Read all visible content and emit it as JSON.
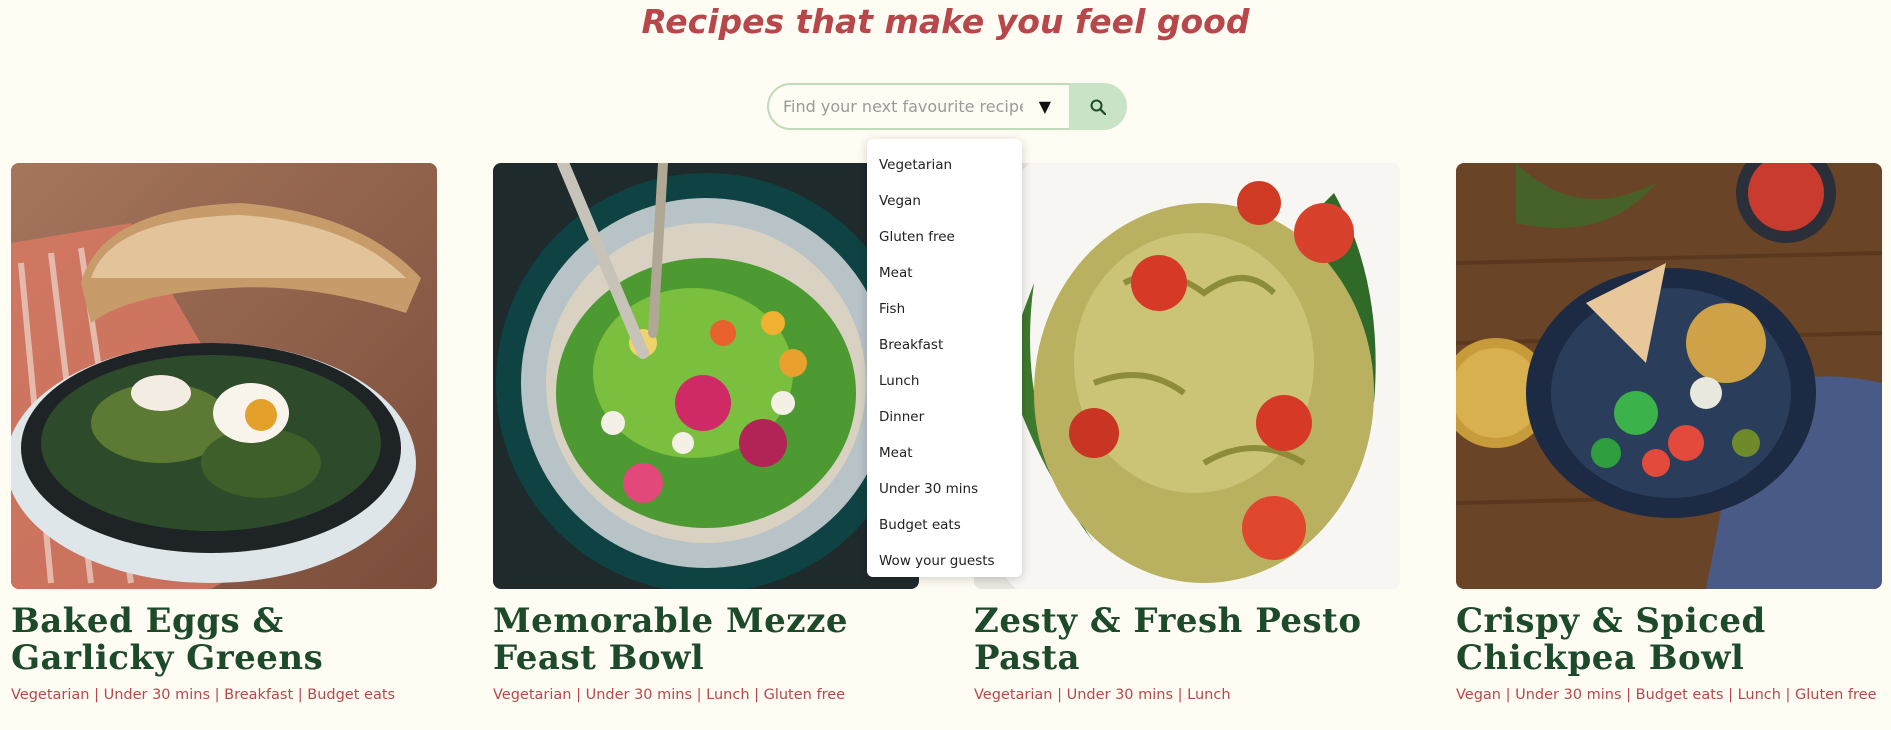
{
  "header": {
    "title": "Recipes that make you feel good"
  },
  "search": {
    "placeholder": "Find your next favourite recipe...",
    "dropdown_icon": "triangle-down-icon",
    "search_icon": "magnifier-icon"
  },
  "dropdown": {
    "options": [
      "Vegetarian",
      "Vegan",
      "Gluten free",
      "Meat",
      "Fish",
      "Breakfast",
      "Lunch",
      "Dinner",
      "Meat",
      "Under 30 mins",
      "Budget eats",
      "Wow your guests"
    ]
  },
  "recipes": [
    {
      "title": "Baked Eggs & Garlicky Greens",
      "tags": "Vegetarian | Under 30 mins | Breakfast | Budget eats"
    },
    {
      "title": "Memorable Mezze Feast Bowl",
      "tags": "Vegetarian | Under 30 mins | Lunch | Gluten free"
    },
    {
      "title": "Zesty & Fresh Pesto Pasta",
      "tags": "Vegetarian | Under 30 mins | Lunch"
    },
    {
      "title": "Crispy & Spiced Chickpea Bowl",
      "tags": "Vegan | Under 30 mins | Budget eats | Lunch | Gluten free"
    }
  ],
  "colors": {
    "accent": "#b8474b",
    "title_green": "#1c4a2a",
    "search_btn": "#c9e3c6",
    "background": "#fffcf3"
  }
}
